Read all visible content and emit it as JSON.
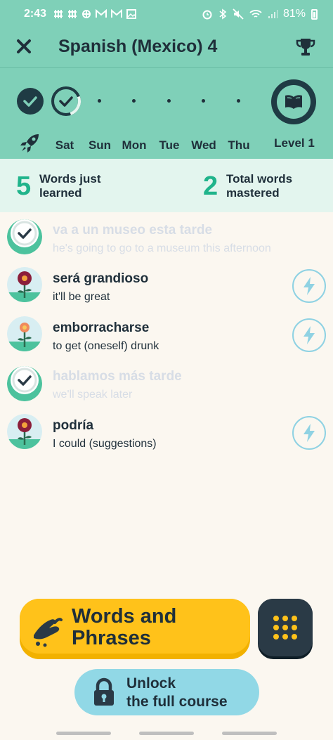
{
  "status_bar": {
    "time": "2:43",
    "battery": "81%"
  },
  "header": {
    "title": "Spanish (Mexico) 4"
  },
  "progress": {
    "days": [
      {
        "label": "Sat",
        "state": "done-ring"
      },
      {
        "label": "Sun",
        "state": "dot"
      },
      {
        "label": "Mon",
        "state": "dot"
      },
      {
        "label": "Tue",
        "state": "dot"
      },
      {
        "label": "Wed",
        "state": "dot"
      },
      {
        "label": "Thu",
        "state": "dot"
      }
    ],
    "level_label": "Level 1"
  },
  "stats": {
    "learned_count": "5",
    "learned_label_1": "Words just",
    "learned_label_2": "learned",
    "mastered_count": "2",
    "mastered_label_1": "Total words",
    "mastered_label_2": "mastered"
  },
  "words": [
    {
      "word": "va a un museo esta tarde",
      "meaning": "he's going to go to a museum this afternoon",
      "status": "mastered",
      "icon": "check-icon"
    },
    {
      "word": "será grandioso",
      "meaning": "it'll be great",
      "status": "learning",
      "icon": "flower-icon",
      "flower_color": "#8b1e3a"
    },
    {
      "word": "emborracharse",
      "meaning": "to get (oneself) drunk",
      "status": "learning",
      "icon": "flower-icon",
      "flower_color": "#f08a5d"
    },
    {
      "word": "hablamos más tarde",
      "meaning": "we'll speak later",
      "status": "mastered",
      "icon": "check-icon"
    },
    {
      "word": "podría",
      "meaning": "I could (suggestions)",
      "status": "learning",
      "icon": "flower-icon",
      "flower_color": "#8b1e3a"
    }
  ],
  "buttons": {
    "words_line1": "Words and",
    "words_line2": "Phrases",
    "unlock_line1": "Unlock",
    "unlock_line2": "the full course"
  },
  "colors": {
    "mint": "#7fd0b8",
    "accent_green": "#20b48b",
    "yellow": "#ffc21a",
    "dark": "#2a3a46",
    "light_blue": "#91d8e6"
  }
}
